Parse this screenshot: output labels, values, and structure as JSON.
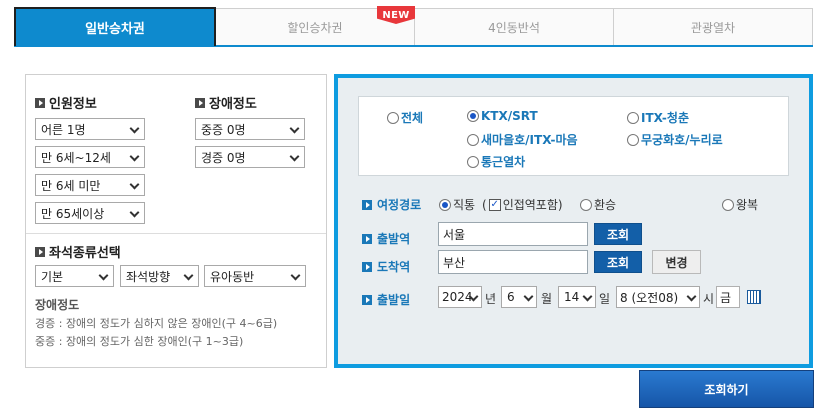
{
  "tabs": [
    {
      "label": "일반승차권",
      "active": true
    },
    {
      "label": "할인승차권",
      "badge": "NEW"
    },
    {
      "label": "4인동반석"
    },
    {
      "label": "관광열차"
    }
  ],
  "passenger": {
    "title": "인원정보",
    "adult": "어른 1명",
    "child": "만 6세~12세",
    "infant": "만 6세 미만",
    "senior": "만 65세이상"
  },
  "disability": {
    "title": "장애정도",
    "severe": "중증 0명",
    "mild": "경증 0명"
  },
  "seat": {
    "title": "좌석종류선택",
    "type": "기본",
    "direction": "좌석방향",
    "infant_seat": "유아동반"
  },
  "note": {
    "title": "장애정도",
    "line1": "경증 : 장애의 정도가 심하지 않은 장애인(구 4~6급)",
    "line2": "중증 : 장애의 정도가 심한 장애인(구 1~3급)"
  },
  "train_types": {
    "all": "전체",
    "ktx": "KTX/SRT",
    "itx_cheongchun": "ITX-청춘",
    "saemaeul": "새마을호/ITX-마음",
    "mugunghwa": "무궁화호/누리로",
    "commuter": "통근열차",
    "selected": "KTX/SRT"
  },
  "route": {
    "label": "여정경로",
    "direct": "직통",
    "adjacent_open": "(",
    "adjacent": "인접역포함)",
    "transfer": "환승",
    "roundtrip": "왕복"
  },
  "departure": {
    "label": "출발역",
    "value": "서울",
    "lookup": "조회"
  },
  "arrival": {
    "label": "도착역",
    "value": "부산",
    "lookup": "조회",
    "swap": "변경"
  },
  "date": {
    "label": "출발일",
    "year": "2024",
    "year_unit": "년",
    "month": "6",
    "month_unit": "월",
    "day": "14",
    "day_unit": "일",
    "hour": "8 (오전08)",
    "hour_unit": "시",
    "weekday": "금"
  },
  "search_button": "조회하기",
  "colors": {
    "accent": "#0e8ace",
    "panel_border": "#0e9ce0",
    "label_blue": "#1a78b8",
    "button_blue": "#135fa8",
    "new_badge": "#e8373b"
  }
}
